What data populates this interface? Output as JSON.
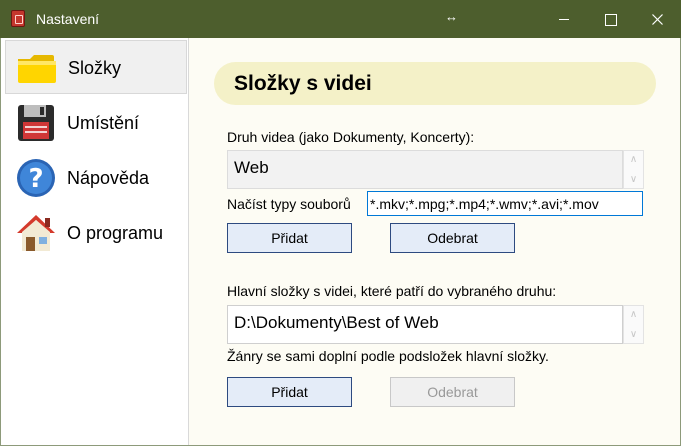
{
  "window": {
    "title": "Nastavení",
    "resize_glyph": "↔"
  },
  "sidebar": {
    "items": [
      {
        "label": "Složky",
        "icon": "folder-icon",
        "selected": true
      },
      {
        "label": "Umístění",
        "icon": "floppy-disk-icon",
        "selected": false
      },
      {
        "label": "Nápověda",
        "icon": "help-icon",
        "selected": false
      },
      {
        "label": "O programu",
        "icon": "home-icon",
        "selected": false
      }
    ]
  },
  "content": {
    "section_title": "Složky s videi",
    "video_type_label": "Druh videa (jako Dokumenty, Koncerty):",
    "video_types": [
      "Web"
    ],
    "file_types_label": "Načíst typy souborů",
    "file_types_value": "*.mkv;*.mpg;*.mp4;*.wmv;*.avi;*.mov",
    "add_label": "Přidat",
    "remove_label": "Odebrat",
    "main_folders_label": "Hlavní složky s videi, které patří do vybraného druhu:",
    "main_folders": [
      "D:\\Dokumenty\\Best of Web"
    ],
    "genres_note": "Žánry se sami doplní podle podsložek hlavní složky.",
    "remove_folder_disabled": true
  },
  "colors": {
    "titlebar": "#4d5e2d",
    "header_pill": "#f4f1c8",
    "content_bg": "#fdfcf4",
    "button_bg": "#e4ecf8",
    "button_border": "#2d4a80",
    "input_focus_border": "#0078d7"
  }
}
